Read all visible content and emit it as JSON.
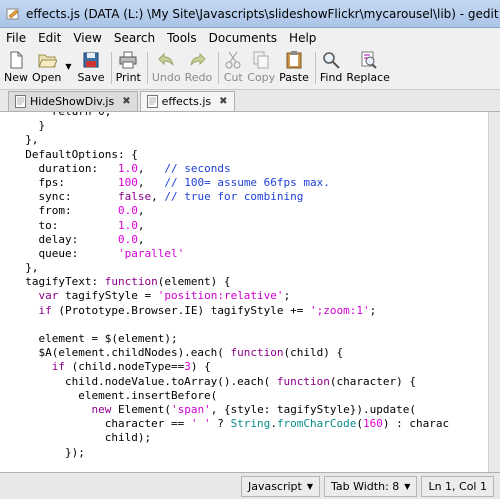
{
  "window": {
    "title": "effects.js (DATA (L:) \\My Site\\Javascripts\\slideshowFlickr\\mycarousel\\lib) - gedit"
  },
  "menubar": {
    "items": [
      {
        "label": "File"
      },
      {
        "label": "Edit"
      },
      {
        "label": "View"
      },
      {
        "label": "Search"
      },
      {
        "label": "Tools"
      },
      {
        "label": "Documents"
      },
      {
        "label": "Help"
      }
    ]
  },
  "toolbar": {
    "new": "New",
    "open": "Open",
    "save": "Save",
    "print": "Print",
    "undo": "Undo",
    "redo": "Redo",
    "cut": "Cut",
    "copy": "Copy",
    "paste": "Paste",
    "find": "Find",
    "replace": "Replace"
  },
  "tabs": [
    {
      "label": "HideShowDiv.js"
    },
    {
      "label": "effects.js"
    }
  ],
  "code": {
    "lines": [
      [
        {
          "t": "      "
        },
        {
          "t": "return 0;"
        }
      ],
      [
        {
          "t": "    }"
        }
      ],
      [
        {
          "t": "  },"
        }
      ],
      [
        {
          "t": "  DefaultOptions: {"
        }
      ],
      [
        {
          "t": "    duration:   "
        },
        {
          "t": "1.0",
          "c": "num"
        },
        {
          "t": ",   "
        },
        {
          "t": "// seconds",
          "c": "cmt"
        }
      ],
      [
        {
          "t": "    fps:        "
        },
        {
          "t": "100",
          "c": "num"
        },
        {
          "t": ",   "
        },
        {
          "t": "// 100= assume 66fps max.",
          "c": "cmt"
        }
      ],
      [
        {
          "t": "    sync:       "
        },
        {
          "t": "false",
          "c": "kw"
        },
        {
          "t": ", "
        },
        {
          "t": "// true for combining",
          "c": "cmt"
        }
      ],
      [
        {
          "t": "    from:       "
        },
        {
          "t": "0.0",
          "c": "num"
        },
        {
          "t": ","
        }
      ],
      [
        {
          "t": "    to:         "
        },
        {
          "t": "1.0",
          "c": "num"
        },
        {
          "t": ","
        }
      ],
      [
        {
          "t": "    delay:      "
        },
        {
          "t": "0.0",
          "c": "num"
        },
        {
          "t": ","
        }
      ],
      [
        {
          "t": "    queue:      "
        },
        {
          "t": "'parallel'",
          "c": "str"
        }
      ],
      [
        {
          "t": "  },"
        }
      ],
      [
        {
          "t": "  tagifyText: "
        },
        {
          "t": "function",
          "c": "kw"
        },
        {
          "t": "(element) {"
        }
      ],
      [
        {
          "t": "    "
        },
        {
          "t": "var",
          "c": "kw"
        },
        {
          "t": " tagifyStyle = "
        },
        {
          "t": "'position:relative'",
          "c": "str"
        },
        {
          "t": ";"
        }
      ],
      [
        {
          "t": "    "
        },
        {
          "t": "if",
          "c": "kw"
        },
        {
          "t": " (Prototype.Browser.IE) tagifyStyle += "
        },
        {
          "t": "';zoom:1'",
          "c": "str"
        },
        {
          "t": ";"
        }
      ],
      [
        {
          "t": ""
        }
      ],
      [
        {
          "t": "    element = $(element);"
        }
      ],
      [
        {
          "t": "    $A(element.childNodes).each( "
        },
        {
          "t": "function",
          "c": "kw"
        },
        {
          "t": "(child) {"
        }
      ],
      [
        {
          "t": "      "
        },
        {
          "t": "if",
          "c": "kw"
        },
        {
          "t": " (child.nodeType=="
        },
        {
          "t": "3",
          "c": "num"
        },
        {
          "t": ") {"
        }
      ],
      [
        {
          "t": "        child.nodeValue.toArray().each( "
        },
        {
          "t": "function",
          "c": "kw"
        },
        {
          "t": "(character) {"
        }
      ],
      [
        {
          "t": "          element.insertBefore("
        }
      ],
      [
        {
          "t": "            "
        },
        {
          "t": "new",
          "c": "kw"
        },
        {
          "t": " Element("
        },
        {
          "t": "'span'",
          "c": "str"
        },
        {
          "t": ", {style: tagifyStyle}).update("
        }
      ],
      [
        {
          "t": "              character == "
        },
        {
          "t": "' '",
          "c": "str"
        },
        {
          "t": " ? "
        },
        {
          "t": "String",
          "c": "fn"
        },
        {
          "t": "."
        },
        {
          "t": "fromCharCode",
          "c": "fn"
        },
        {
          "t": "("
        },
        {
          "t": "160",
          "c": "num"
        },
        {
          "t": ") : charac"
        }
      ],
      [
        {
          "t": "              child);"
        }
      ],
      [
        {
          "t": "        });"
        }
      ]
    ]
  },
  "statusbar": {
    "language": "Javascript",
    "tab_width": "Tab Width: 8",
    "position": "Ln 1, Col 1"
  },
  "colors": {
    "keyword": "#8b008b",
    "number": "#e000e0",
    "string": "#d000d0",
    "comment": "#1e3fd8",
    "builtin": "#0b8b8b"
  }
}
